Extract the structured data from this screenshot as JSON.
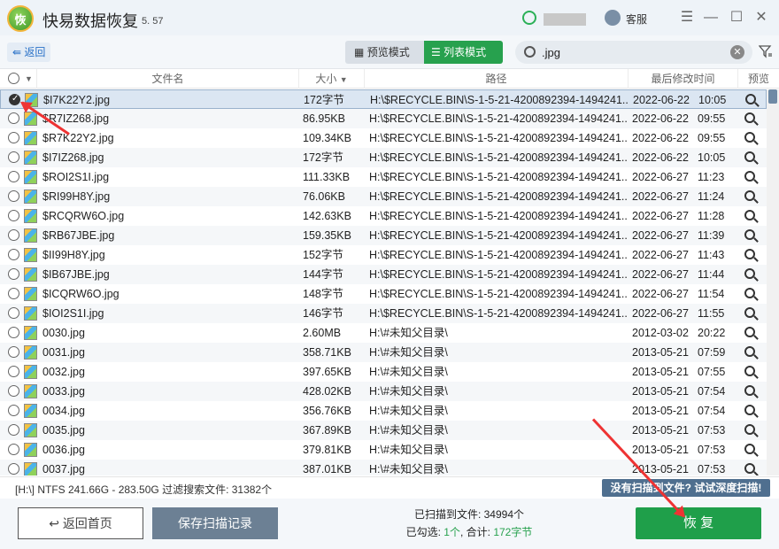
{
  "app": {
    "logo_text": "恢",
    "title": "快易数据恢复",
    "version": "5. 57",
    "service_label": "客服"
  },
  "toolbar": {
    "back_label": "返回",
    "preview_mode_label": "预览模式",
    "list_mode_label": "列表模式",
    "search_value": ".jpg"
  },
  "columns": {
    "name": "文件名",
    "size": "大小",
    "path": "路径",
    "modified": "最后修改时间",
    "preview": "预览"
  },
  "rows": [
    {
      "name": "$I7K22Y2.jpg",
      "size": "172字节",
      "path": "H:\\$RECYCLE.BIN\\S-1-5-21-4200892394-1494241...",
      "date": "2022-06-22",
      "time": "10:05",
      "checked": true
    },
    {
      "name": "$R7IZ268.jpg",
      "size": "86.95KB",
      "path": "H:\\$RECYCLE.BIN\\S-1-5-21-4200892394-1494241...",
      "date": "2022-06-22",
      "time": "09:55",
      "checked": false
    },
    {
      "name": "$R7K22Y2.jpg",
      "size": "109.34KB",
      "path": "H:\\$RECYCLE.BIN\\S-1-5-21-4200892394-1494241...",
      "date": "2022-06-22",
      "time": "09:55",
      "checked": false
    },
    {
      "name": "$I7IZ268.jpg",
      "size": "172字节",
      "path": "H:\\$RECYCLE.BIN\\S-1-5-21-4200892394-1494241...",
      "date": "2022-06-22",
      "time": "10:05",
      "checked": false
    },
    {
      "name": "$ROI2S1I.jpg",
      "size": "111.33KB",
      "path": "H:\\$RECYCLE.BIN\\S-1-5-21-4200892394-1494241...",
      "date": "2022-06-27",
      "time": "11:23",
      "checked": false
    },
    {
      "name": "$RI99H8Y.jpg",
      "size": "76.06KB",
      "path": "H:\\$RECYCLE.BIN\\S-1-5-21-4200892394-1494241...",
      "date": "2022-06-27",
      "time": "11:24",
      "checked": false
    },
    {
      "name": "$RCQRW6O.jpg",
      "size": "142.63KB",
      "path": "H:\\$RECYCLE.BIN\\S-1-5-21-4200892394-1494241...",
      "date": "2022-06-27",
      "time": "11:28",
      "checked": false
    },
    {
      "name": "$RB67JBE.jpg",
      "size": "159.35KB",
      "path": "H:\\$RECYCLE.BIN\\S-1-5-21-4200892394-1494241...",
      "date": "2022-06-27",
      "time": "11:39",
      "checked": false
    },
    {
      "name": "$II99H8Y.jpg",
      "size": "152字节",
      "path": "H:\\$RECYCLE.BIN\\S-1-5-21-4200892394-1494241...",
      "date": "2022-06-27",
      "time": "11:43",
      "checked": false
    },
    {
      "name": "$IB67JBE.jpg",
      "size": "144字节",
      "path": "H:\\$RECYCLE.BIN\\S-1-5-21-4200892394-1494241...",
      "date": "2022-06-27",
      "time": "11:44",
      "checked": false
    },
    {
      "name": "$ICQRW6O.jpg",
      "size": "148字节",
      "path": "H:\\$RECYCLE.BIN\\S-1-5-21-4200892394-1494241...",
      "date": "2022-06-27",
      "time": "11:54",
      "checked": false
    },
    {
      "name": "$IOI2S1I.jpg",
      "size": "146字节",
      "path": "H:\\$RECYCLE.BIN\\S-1-5-21-4200892394-1494241...",
      "date": "2022-06-27",
      "time": "11:55",
      "checked": false
    },
    {
      "name": "0030.jpg",
      "size": "2.60MB",
      "path": "H:\\#未知父目录\\",
      "date": "2012-03-02",
      "time": "20:22",
      "checked": false
    },
    {
      "name": "0031.jpg",
      "size": "358.71KB",
      "path": "H:\\#未知父目录\\",
      "date": "2013-05-21",
      "time": "07:59",
      "checked": false
    },
    {
      "name": "0032.jpg",
      "size": "397.65KB",
      "path": "H:\\#未知父目录\\",
      "date": "2013-05-21",
      "time": "07:55",
      "checked": false
    },
    {
      "name": "0033.jpg",
      "size": "428.02KB",
      "path": "H:\\#未知父目录\\",
      "date": "2013-05-21",
      "time": "07:54",
      "checked": false
    },
    {
      "name": "0034.jpg",
      "size": "356.76KB",
      "path": "H:\\#未知父目录\\",
      "date": "2013-05-21",
      "time": "07:54",
      "checked": false
    },
    {
      "name": "0035.jpg",
      "size": "367.89KB",
      "path": "H:\\#未知父目录\\",
      "date": "2013-05-21",
      "time": "07:53",
      "checked": false
    },
    {
      "name": "0036.jpg",
      "size": "379.81KB",
      "path": "H:\\#未知父目录\\",
      "date": "2013-05-21",
      "time": "07:53",
      "checked": false
    },
    {
      "name": "0037.jpg",
      "size": "387.01KB",
      "path": "H:\\#未知父目录\\",
      "date": "2013-05-21",
      "time": "07:53",
      "checked": false
    }
  ],
  "status": {
    "text": "[H:\\] NTFS 241.66G - 283.50G 过滤搜索文件: 31382个",
    "deep_scan_label": "没有扫描到文件? 试试深度扫描!"
  },
  "footer": {
    "home_label": "返回首页",
    "save_label": "保存扫描记录",
    "scanned_label": "已扫描到文件: 34994个",
    "checked_prefix": "已勾选: ",
    "checked_count": "1个",
    "total_prefix": ", 合计: ",
    "total_size": "172字节",
    "recover_label": "恢 复"
  },
  "colors": {
    "accent_green": "#27a14e",
    "recover_green": "#1f9f4a",
    "annotation_red": "#e33333"
  }
}
